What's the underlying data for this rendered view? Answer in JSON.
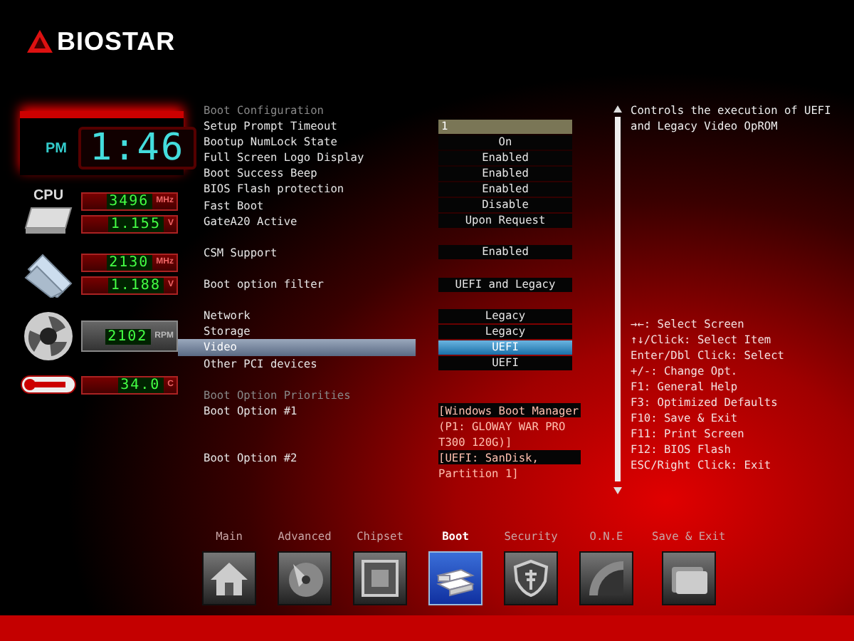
{
  "brand": {
    "name": "BIOSTAR"
  },
  "clock": {
    "period": "PM",
    "time": "1:46"
  },
  "monitors": [
    {
      "kind": "cpu",
      "label": "CPU",
      "readings": [
        {
          "value": "3496",
          "unit": "MHz"
        },
        {
          "value": "1.155",
          "unit": "V"
        }
      ]
    },
    {
      "kind": "memory",
      "readings": [
        {
          "value": "2130",
          "unit": "MHz"
        },
        {
          "value": "1.188",
          "unit": "V"
        }
      ]
    },
    {
      "kind": "fan",
      "readings": [
        {
          "value": "2102",
          "unit": "RPM"
        }
      ]
    },
    {
      "kind": "temperature",
      "readings": [
        {
          "value": "34.0",
          "unit": "C"
        }
      ]
    }
  ],
  "settings": [
    {
      "title": "Boot Configuration",
      "items": [
        {
          "label": "Setup Prompt Timeout",
          "value": "1",
          "kind": "input",
          "selected": false
        },
        {
          "label": "Bootup NumLock State",
          "value": "On",
          "kind": "select",
          "selected": false
        },
        {
          "label": "Full Screen Logo Display",
          "value": "Enabled",
          "kind": "select",
          "selected": false
        },
        {
          "label": "Boot Success Beep",
          "value": "Enabled",
          "kind": "select",
          "selected": false
        },
        {
          "label": "BIOS Flash protection",
          "value": "Enabled",
          "kind": "select",
          "selected": false
        },
        {
          "label": "Fast Boot",
          "value": "Disable",
          "kind": "select",
          "selected": false
        },
        {
          "label": "GateA20 Active",
          "value": "Upon Request",
          "kind": "select",
          "selected": false
        }
      ]
    },
    {
      "items": [
        {
          "label": "CSM Support",
          "value": "Enabled",
          "kind": "select",
          "selected": false
        }
      ]
    },
    {
      "items": [
        {
          "label": "Boot option filter",
          "value": "UEFI and Legacy",
          "kind": "select",
          "selected": false
        }
      ]
    },
    {
      "items": [
        {
          "label": "Network",
          "value": "Legacy",
          "kind": "select",
          "selected": false
        },
        {
          "label": "Storage",
          "value": "Legacy",
          "kind": "select",
          "selected": false
        },
        {
          "label": "Video",
          "value": "UEFI",
          "kind": "select",
          "selected": true
        },
        {
          "label": "Other PCI devices",
          "value": "UEFI",
          "kind": "select",
          "selected": false
        }
      ]
    },
    {
      "title": "Boot Option Priorities",
      "items": [
        {
          "label": "Boot Option #1",
          "value": "[Windows Boot Manager (P1: GLOWAY WAR PRO T300 120G)]",
          "kind": "boot",
          "selected": false
        },
        {
          "label": "Boot Option #2",
          "value": "[UEFI: SanDisk, Partition 1]",
          "kind": "boot",
          "selected": false
        }
      ]
    }
  ],
  "help": {
    "description": "Controls the execution of UEFI and Legacy Video OpROM",
    "keys": [
      "→←: Select Screen",
      "↑↓/Click: Select Item",
      "Enter/Dbl Click: Select",
      "+/-: Change Opt.",
      "F1: General Help",
      "F3: Optimized Defaults",
      "F10: Save & Exit",
      "F11: Print Screen",
      "F12: BIOS Flash",
      "ESC/Right Click: Exit"
    ]
  },
  "tabs": [
    {
      "label": "Main",
      "kind": "main",
      "selected": false
    },
    {
      "label": "Advanced",
      "kind": "advanced",
      "selected": false
    },
    {
      "label": "Chipset",
      "kind": "chipset",
      "selected": false
    },
    {
      "label": "Boot",
      "kind": "boot",
      "selected": true
    },
    {
      "label": "Security",
      "kind": "security",
      "selected": false
    },
    {
      "label": "O.N.E",
      "kind": "one",
      "selected": false
    },
    {
      "label": "Save & Exit",
      "kind": "exit",
      "selected": false
    }
  ]
}
